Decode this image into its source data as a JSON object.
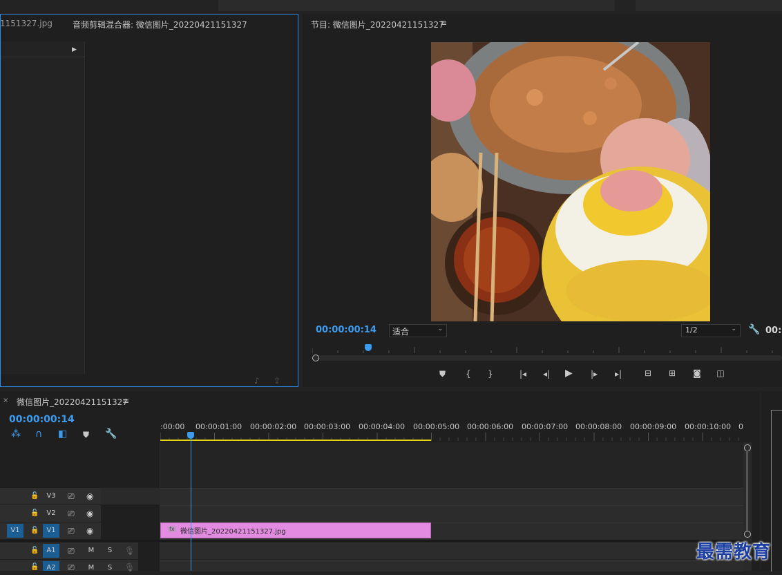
{
  "top_bar": {
    "tabs": [
      "",
      "",
      "",
      "",
      "",
      "",
      "",
      ""
    ]
  },
  "left_panel": {
    "source_name": "1151327.jpg",
    "mixer_title": "音频剪辑混合器: 微信图片_20220421151327"
  },
  "program_monitor": {
    "title": "节目: 微信图片_20220421151327",
    "timecode": "00:00:00:14",
    "fit_select": "适合",
    "resolution_select": "1/2",
    "timecode_right": "00:",
    "controls": [
      "add-marker",
      "mark-in",
      "mark-out",
      "go-to-in",
      "step-back",
      "play",
      "step-forward",
      "go-to-out",
      "lift",
      "extract",
      "export-frame",
      "compare"
    ]
  },
  "timeline": {
    "sequence_name": "微信图片_20220421151327",
    "timecode": "00:00:00:14",
    "ruler_labels": [
      ":00:00",
      "00:00:01:00",
      "00:00:02:00",
      "00:00:03:00",
      "00:00:04:00",
      "00:00:05:00",
      "00:00:06:00",
      "00:00:07:00",
      "00:00:08:00",
      "00:00:09:00",
      "00:00:10:00",
      "0"
    ],
    "tracks": {
      "v3": {
        "label": "V3"
      },
      "v2": {
        "label": "V2"
      },
      "v1": {
        "label": "V1",
        "source_label": "V1"
      },
      "a1": {
        "label": "A1",
        "m": "M",
        "s": "S"
      },
      "a2": {
        "label": "A2",
        "m": "M",
        "s": "S"
      }
    },
    "clip": {
      "name": "微信图片_20220421151327.jpg",
      "fx": "fx",
      "color": "#e38be0"
    },
    "playhead_frame": 14
  },
  "watermark": "最需教育",
  "colors": {
    "accent": "#3c9cf0",
    "work_area": "#e7d21c",
    "clip": "#e38be0"
  }
}
